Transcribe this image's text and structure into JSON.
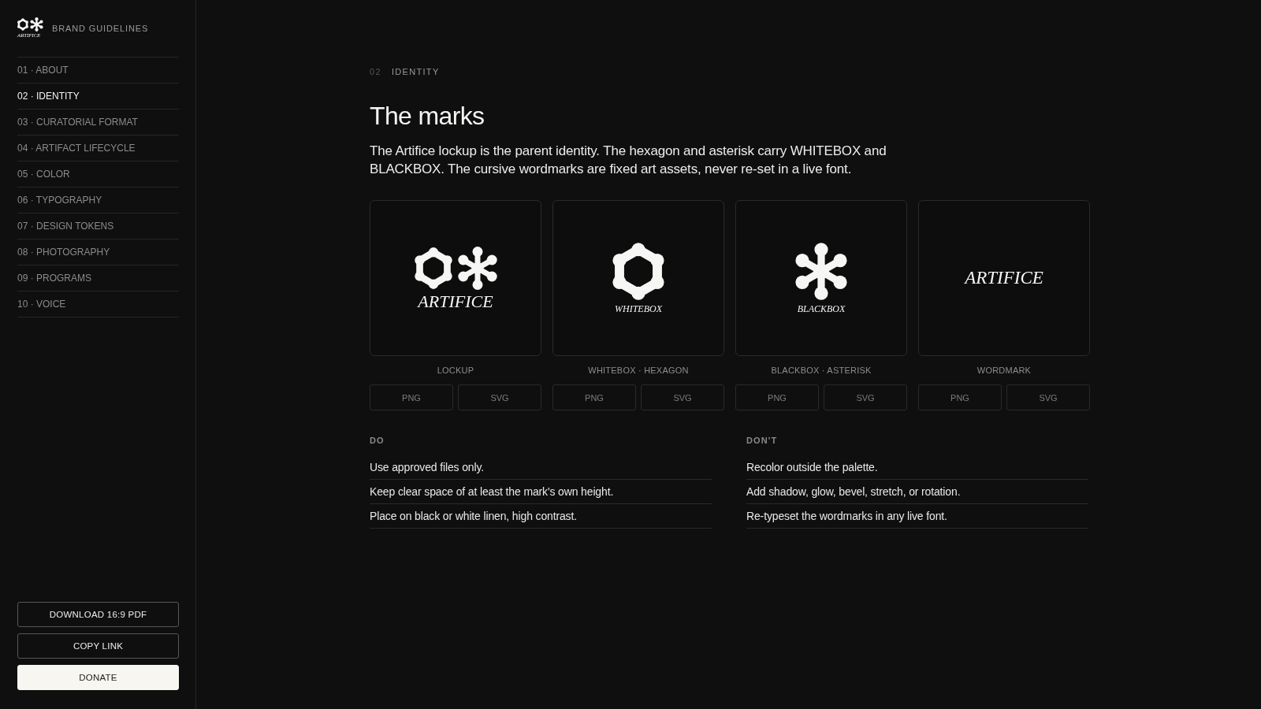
{
  "sidebar": {
    "logo": {
      "wordmark": "ARTIFICE"
    },
    "title": "BRAND GUIDELINES",
    "nav": [
      {
        "label": "01 · ABOUT",
        "selected": false
      },
      {
        "label": "02 · IDENTITY",
        "selected": true
      },
      {
        "label": "03 · CURATORIAL FORMAT",
        "selected": false
      },
      {
        "label": "04 · ARTIFACT LIFECYCLE",
        "selected": false
      },
      {
        "label": "05 · COLOR",
        "selected": false
      },
      {
        "label": "06 · TYPOGRAPHY",
        "selected": false
      },
      {
        "label": "07 · DESIGN TOKENS",
        "selected": false
      },
      {
        "label": "08 · PHOTOGRAPHY",
        "selected": false
      },
      {
        "label": "09 · PROGRAMS",
        "selected": false
      },
      {
        "label": "10 · VOICE",
        "selected": false
      }
    ],
    "actions": [
      {
        "label": "DOWNLOAD 16:9 PDF",
        "kind": "outline"
      },
      {
        "label": "COPY LINK",
        "kind": "outline"
      },
      {
        "label": "DONATE",
        "kind": "filled"
      }
    ]
  },
  "main": {
    "section": {
      "number": "02",
      "name": "IDENTITY"
    },
    "title": "The marks",
    "intro": "The Artifice lockup is the parent identity. The hexagon and asterisk carry WHITEBOX and BLACKBOX. The cursive wordmarks are fixed art assets, never re-set in a live font.",
    "marks": [
      {
        "kind": "lockup",
        "wordmark": "ARTIFICE",
        "label": "LOCKUP",
        "formats": [
          "PNG",
          "SVG"
        ]
      },
      {
        "kind": "hexagon",
        "wordmark": "WHITEBOX",
        "label": "WHITEBOX · HEXAGON",
        "formats": [
          "PNG",
          "SVG"
        ]
      },
      {
        "kind": "asterisk",
        "wordmark": "BLACKBOX",
        "label": "BLACKBOX · ASTERISK",
        "formats": [
          "PNG",
          "SVG"
        ]
      },
      {
        "kind": "wordmark",
        "wordmark": "ARTIFICE",
        "label": "WORDMARK",
        "formats": [
          "PNG",
          "SVG"
        ]
      }
    ],
    "guidance": [
      {
        "heading": "DO",
        "items": [
          "Use approved files only.",
          "Keep clear space of at least the mark's own height.",
          "Place on black or white linen, high contrast."
        ]
      },
      {
        "heading": "DON'T",
        "items": [
          "Recolor outside the palette.",
          "Add shadow, glow, bevel, stretch, or rotation.",
          "Re-typeset the wordmarks in any live font."
        ]
      }
    ]
  }
}
